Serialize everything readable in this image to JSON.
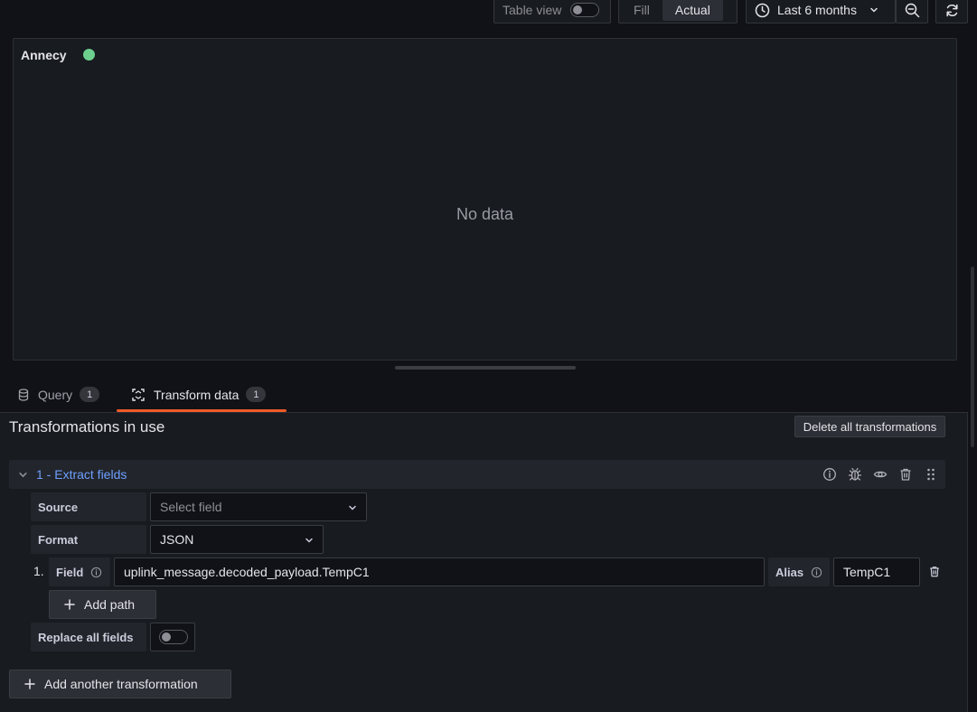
{
  "toolbar": {
    "table_view_label": "Table view",
    "fill_label": "Fill",
    "actual_label": "Actual",
    "time_range": "Last 6 months"
  },
  "panel": {
    "title": "Annecy",
    "empty_message": "No data"
  },
  "tabs": [
    {
      "label": "Query",
      "count": "1"
    },
    {
      "label": "Transform data",
      "count": "1"
    }
  ],
  "transformations": {
    "heading": "Transformations in use",
    "delete_all_label": "Delete all transformations",
    "item_title": "1 - Extract fields",
    "source_label": "Source",
    "source_placeholder": "Select field",
    "format_label": "Format",
    "format_value": "JSON",
    "path_index": "1.",
    "field_label": "Field",
    "field_value": "uplink_message.decoded_payload.TempC1",
    "alias_label": "Alias",
    "alias_value": "TempC1",
    "add_path_label": "Add path",
    "replace_all_label": "Replace all fields",
    "add_another_label": "Add another transformation"
  },
  "colors": {
    "status_dot": "#6ccf8e",
    "active_tab_underline": "#f05a28",
    "transform_title": "#6e9fff"
  }
}
